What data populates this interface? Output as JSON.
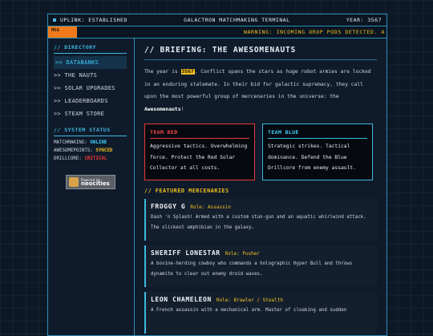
{
  "topbar": {
    "uplink": "UPLINK: ESTABLISHED",
    "title": "GALACTRON MATCHMAKING TERMINAL",
    "year": "YEAR: 3567"
  },
  "ticker": {
    "tag": "MSG",
    "message": "WARNING: INCOMING DROP PODS DETECTED. A"
  },
  "sidebar": {
    "directory_heading": "// DIRECTORY",
    "items": [
      {
        "label": ">> DATABANKS",
        "active": true
      },
      {
        "label": ">> THE NAUTS",
        "active": false
      },
      {
        "label": ">> SOLAR UPGRADES",
        "active": false
      },
      {
        "label": ">> LEADERBOARDS",
        "active": false
      },
      {
        "label": ">> STEAM STORE",
        "active": false
      }
    ],
    "status_heading": "// SYSTEM STATUS",
    "status": [
      {
        "label": "MATCHMAKING: ",
        "value": "ONLINE"
      },
      {
        "label": "AWESOMEPOINTS: ",
        "value": "SYNCED"
      },
      {
        "label": "DRILLCORE: ",
        "value": "CRITICAL"
      }
    ],
    "badge": {
      "small": "Powered by",
      "big": "neocities"
    }
  },
  "main": {
    "heading": "// BRIEFING: THE AWESOMENAUTS",
    "intro": {
      "before_year": "The year is ",
      "year": "3567",
      "after_year": ". Conflict spans the stars as huge robot armies are locked in an enduring stalemate. In their bid for galactic supremacy, they call upon the most powerful group of mercenaries in the universe: the ",
      "name": "Awesomenauts",
      "end": "!"
    },
    "teams": [
      {
        "title": "TEAM RED",
        "body": "Aggressive tactics. Overwhelming force. Protect the Red Solar Collector at all costs."
      },
      {
        "title": "TEAM BLUE",
        "body": "Strategic strikes. Tactical dominance. Defend the Blue Drillcore from enemy assault."
      }
    ],
    "featured_heading": "// FEATURED MERCENARIES",
    "mercs": [
      {
        "name": "FROGGY G",
        "role": "Role: Assassin",
        "desc": "Dash 'n Splash! Armed with a custom stun-gun and an aquatic whirlwind attack. The slickest amphibian in the galaxy."
      },
      {
        "name": "SHERIFF LONESTAR",
        "role": "Role: Pusher",
        "desc": "A bovine-herding cowboy who commands a holographic Hyper Bull and throws dynamite to clear out enemy droid waves."
      },
      {
        "name": "LEON CHAMELEON",
        "role": "Role: Brawler / Stealth",
        "desc": "A French assassin with a mechanical arm. Master of cloaking and sudden"
      }
    ]
  },
  "colors": {
    "accent": "#3fb8e0",
    "warning": "#f0c020",
    "red": "#e03a3a",
    "ticker_tag": "#f07a1a"
  }
}
